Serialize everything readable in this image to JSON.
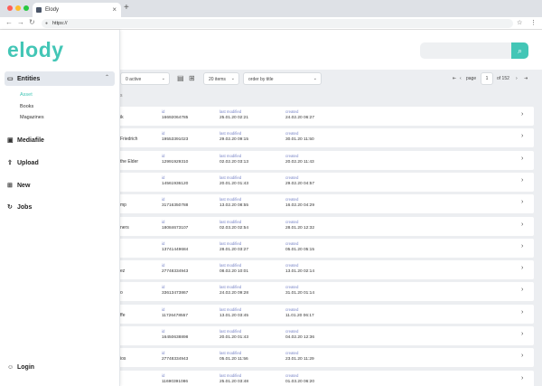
{
  "browser": {
    "colors": {
      "close": "#ff5f57",
      "min": "#febc2e",
      "max": "#28c840"
    },
    "tab_title": "Elody",
    "tab_close_icon": "close-icon",
    "new_tab": "+",
    "back": "←",
    "forward": "→",
    "reload": "↻",
    "url": "https://",
    "star": "☆",
    "menu": "⋮"
  },
  "brand": {
    "logo_text": "elody",
    "accent": "#43c6b6"
  },
  "sidebar": {
    "entities": {
      "label": "Entities",
      "icon": "entities-icon",
      "chevron": "⌃"
    },
    "subitems": [
      {
        "label": "Asset",
        "active": true
      },
      {
        "label": "Books",
        "active": false
      },
      {
        "label": "Magazines",
        "active": false
      }
    ],
    "items": [
      {
        "label": "Mediafile",
        "icon": "image-icon",
        "glyph": "▣"
      },
      {
        "label": "Upload",
        "icon": "upload-icon",
        "glyph": "⇧"
      },
      {
        "label": "New",
        "icon": "grid-icon",
        "glyph": "⊞"
      },
      {
        "label": "Jobs",
        "icon": "refresh-icon",
        "glyph": "↻"
      }
    ],
    "login": {
      "label": "Login",
      "icon": "user-icon",
      "glyph": "☺"
    }
  },
  "search": {
    "placeholder": "",
    "button_icon": "search-icon",
    "button_glyph": "⌕"
  },
  "filters": {
    "active": "0 active",
    "items_per_page": "20 items",
    "order": "order by title"
  },
  "pagination": {
    "first": "⇤",
    "prev": "‹",
    "page_label": "page",
    "page": "1",
    "of_label": "of 152",
    "next": "›",
    "last": "⇥"
  },
  "section_label": "s",
  "columns": {
    "id": "id",
    "last_modified": "last modified",
    "created": "created"
  },
  "rows": [
    {
      "title": "ik",
      "id": "16692064785",
      "modified": "25.01.20 02:21",
      "created": "24.02.20 06:27"
    },
    {
      "title": "Friedrich",
      "id": "19553391023",
      "modified": "29.02.20 09:15",
      "created": "30.01.20 11:50"
    },
    {
      "title": "the Elder",
      "id": "12991929310",
      "modified": "02.02.20 03:13",
      "created": "20.02.20 11:43"
    },
    {
      "title": "",
      "id": "14561936120",
      "modified": "20.01.20 01:43",
      "created": "29.02.20 04:57"
    },
    {
      "title": "mp",
      "id": "31716350788",
      "modified": "13.02.20 08:55",
      "created": "16.02.20 04:29"
    },
    {
      "title": "ners",
      "id": "18084673107",
      "modified": "02.03.20 02:54",
      "created": "28.01.20 12:32"
    },
    {
      "title": "",
      "id": "13741449684",
      "modified": "28.01.20 03:27",
      "created": "05.01.20 05:15"
    },
    {
      "title": "ez",
      "id": "27748334943",
      "modified": "08.02.20 10:01",
      "created": "13.01.20 02:14"
    },
    {
      "title": "o",
      "id": "33613473867",
      "modified": "24.02.20 09:28",
      "created": "31.01.20 01:14"
    },
    {
      "title": "ffe",
      "id": "11726478557",
      "modified": "13.01.20 03:45",
      "created": "11.01.20 06:17"
    },
    {
      "title": "",
      "id": "16450638898",
      "modified": "20.01.20 01:43",
      "created": "04.02.20 12:36"
    },
    {
      "title": "ios",
      "id": "27748334943",
      "modified": "05.01.20 11:56",
      "created": "23.01.20 11:29"
    },
    {
      "title": "",
      "id": "11690391086",
      "modified": "25.01.20 03:48",
      "created": "01.03.20 06:20"
    }
  ]
}
